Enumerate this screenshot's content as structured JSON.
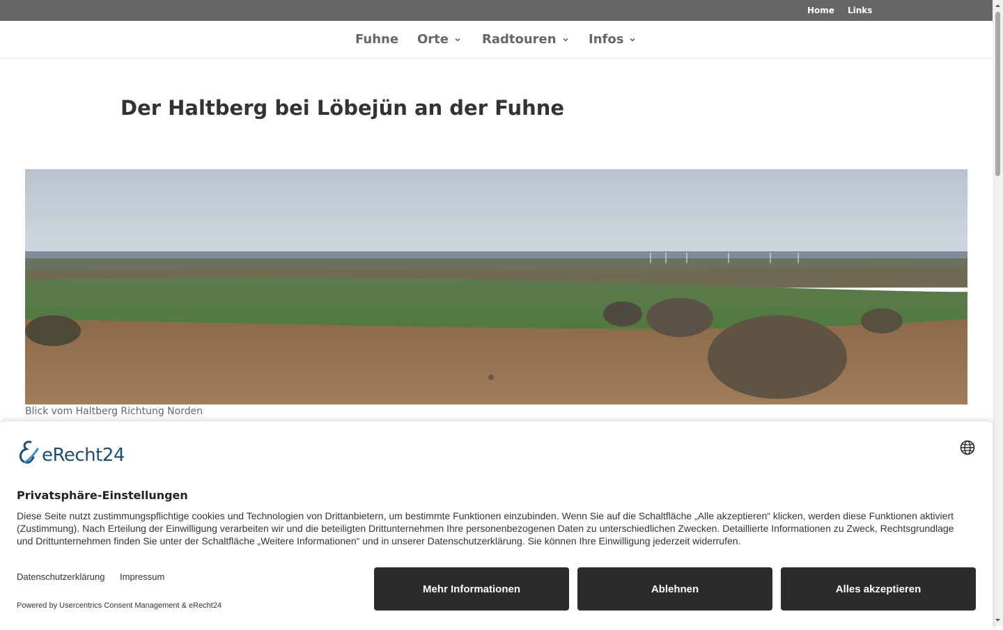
{
  "topbar": {
    "home": "Home",
    "links": "Links"
  },
  "nav": {
    "items": [
      {
        "label": "Fuhne",
        "dropdown": false
      },
      {
        "label": "Orte",
        "dropdown": true
      },
      {
        "label": "Radtouren",
        "dropdown": true
      },
      {
        "label": "Infos",
        "dropdown": true
      }
    ]
  },
  "page": {
    "title": "Der Haltberg bei Löbejün an der Fuhne",
    "image_caption": "Blick vom Haltberg Richtung Norden"
  },
  "consent": {
    "brand": "eRecht24",
    "title": "Privatsphäre-Einstellungen",
    "text": "Diese Seite nutzt zustimmungspflichtige cookies und Technologien von Drittanbietern, um bestimmte Funktionen einzubinden. Wenn Sie auf die Schaltfläche „Alle akzeptieren“ klicken, werden diese Funktionen aktiviert (Zustimmung). Nach Erteilung der Einwilligung verarbeiten wir und die beteiligten Drittunternehmen Ihre personenbezogenen Daten zu unterschiedlichen Zwecken. Detaillierte Informationen zu Zweck, Rechtsgrundlage und Drittunternehmen finden Sie unter der Schaltfläche „Weitere Informationen“ und in unserer Datenschutzerklärung. Sie können Ihre Einwilligung jederzeit widerrufen.",
    "link_privacy": "Datenschutzerklärung",
    "link_imprint": "Impressum",
    "powered_by": "Powered by Usercentrics Consent Management & eRecht24",
    "btn_more": "Mehr Informationen",
    "btn_decline": "Ablehnen",
    "btn_accept": "Alles akzeptieren"
  },
  "colors": {
    "topbar": "#666666",
    "button": "#2b2b2b",
    "brand": "#1b4e73"
  }
}
